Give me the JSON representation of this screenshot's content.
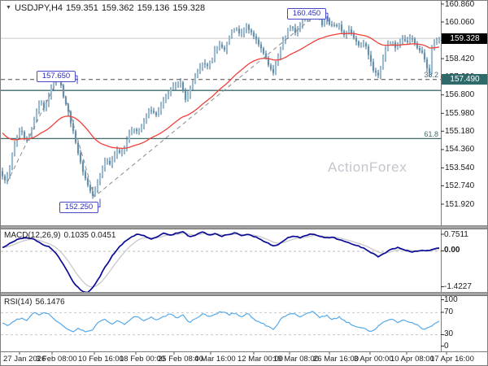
{
  "window": {
    "symbol": "USDJPY,H4",
    "quote_open": "159.351",
    "quote_high": "159.362",
    "quote_low": "159.136",
    "quote_close": "159.328"
  },
  "watermark": "ActionForex",
  "chart_data": [
    {
      "id": "price",
      "type": "candlestick",
      "title": "USDJPY,H4",
      "ohlc": {
        "open": 159.351,
        "high": 159.362,
        "low": 159.136,
        "close": 159.328
      },
      "y_axis": {
        "side": "right",
        "ticks": [
          "160.860",
          "160.060",
          "159.240",
          "158.420",
          "157.600",
          "156.800",
          "155.980",
          "155.180",
          "154.360",
          "153.540",
          "152.740",
          "151.920"
        ]
      },
      "x_axis": {
        "labels": [
          "27 Jan 2026",
          "3 Feb 08:00",
          "10 Feb 16:00",
          "18 Feb 00:00",
          "25 Feb 08:00",
          "4 Mar 16:00",
          "12 Mar 00:00",
          "19 Mar 08:00",
          "26 Mar 16:00",
          "3 Apr 00:00",
          "10 Apr 08:00",
          "17 Apr 16:00"
        ]
      },
      "current_price": {
        "value": 159.328,
        "tag": "159.328"
      },
      "levels": [
        {
          "label": "38.2",
          "price": 157.49,
          "style": "dashed",
          "tag": "157.490"
        },
        {
          "label": "",
          "price": 157.0,
          "style": "solid",
          "tag": ""
        },
        {
          "label": "61.8",
          "price": 154.85,
          "style": "solid",
          "tag": ""
        }
      ],
      "annotations": [
        {
          "label": "160.450",
          "price": 160.45,
          "x": 390,
          "box_x": 352,
          "side": "high"
        },
        {
          "label": "157.650",
          "price": 157.65,
          "x": 72,
          "box_x": 44,
          "side": "high"
        },
        {
          "label": "152.250",
          "price": 152.25,
          "x": 115,
          "box_x": 72,
          "side": "low"
        }
      ],
      "zigzag": [
        [
          8,
          152.9
        ],
        [
          72,
          157.65
        ],
        [
          115,
          152.25
        ],
        [
          390,
          160.45
        ]
      ],
      "price_path": [
        [
          0,
          153.4
        ],
        [
          6,
          152.9
        ],
        [
          12,
          153.6
        ],
        [
          20,
          154.8
        ],
        [
          26,
          155.4
        ],
        [
          32,
          154.7
        ],
        [
          38,
          155.1
        ],
        [
          44,
          155.9
        ],
        [
          50,
          156.5
        ],
        [
          56,
          156.2
        ],
        [
          62,
          157.0
        ],
        [
          68,
          157.4
        ],
        [
          72,
          157.65
        ],
        [
          78,
          156.8
        ],
        [
          84,
          156.1
        ],
        [
          90,
          155.2
        ],
        [
          96,
          154.2
        ],
        [
          102,
          153.5
        ],
        [
          108,
          152.8
        ],
        [
          115,
          152.25
        ],
        [
          122,
          153.1
        ],
        [
          130,
          153.9
        ],
        [
          136,
          153.6
        ],
        [
          144,
          154.4
        ],
        [
          150,
          154.1
        ],
        [
          158,
          154.9
        ],
        [
          164,
          155.4
        ],
        [
          170,
          155.1
        ],
        [
          178,
          155.7
        ],
        [
          186,
          156.2
        ],
        [
          192,
          155.8
        ],
        [
          200,
          156.4
        ],
        [
          208,
          156.9
        ],
        [
          214,
          157.2
        ],
        [
          222,
          157.4
        ],
        [
          228,
          156.6
        ],
        [
          234,
          157.0
        ],
        [
          242,
          157.7
        ],
        [
          250,
          158.3
        ],
        [
          256,
          158.0
        ],
        [
          264,
          158.7
        ],
        [
          270,
          159.1
        ],
        [
          276,
          158.8
        ],
        [
          284,
          159.5
        ],
        [
          290,
          159.8
        ],
        [
          296,
          159.4
        ],
        [
          304,
          159.9
        ],
        [
          310,
          159.5
        ],
        [
          318,
          159.1
        ],
        [
          324,
          158.7
        ],
        [
          330,
          158.2
        ],
        [
          337,
          157.7
        ],
        [
          344,
          158.8
        ],
        [
          352,
          159.5
        ],
        [
          358,
          159.9
        ],
        [
          364,
          159.6
        ],
        [
          372,
          160.1
        ],
        [
          380,
          160.3
        ],
        [
          390,
          160.45
        ],
        [
          396,
          159.9
        ],
        [
          402,
          160.15
        ],
        [
          410,
          159.8
        ],
        [
          416,
          160.0
        ],
        [
          424,
          159.5
        ],
        [
          430,
          159.8
        ],
        [
          436,
          159.3
        ],
        [
          442,
          158.9
        ],
        [
          448,
          159.2
        ],
        [
          454,
          158.5
        ],
        [
          460,
          157.9
        ],
        [
          465,
          157.6
        ],
        [
          470,
          158.3
        ],
        [
          476,
          158.9
        ],
        [
          482,
          159.2
        ],
        [
          488,
          158.9
        ],
        [
          494,
          159.3
        ],
        [
          500,
          159.1
        ],
        [
          506,
          159.4
        ],
        [
          512,
          159.0
        ],
        [
          518,
          158.8
        ],
        [
          524,
          158.3
        ],
        [
          528,
          157.6
        ],
        [
          532,
          159.0
        ],
        [
          536,
          159.2
        ],
        [
          541,
          159.33
        ]
      ],
      "ma": {
        "name": "EMA",
        "color": "#ef4038"
      },
      "colors": {
        "candle_up": "#9cbcd2",
        "candle_down": "#6490ae",
        "candle_line": "#36688e",
        "current_line": "#c9c9c9",
        "level_solid": "#3f6b6b",
        "level_dashed": "#4a4a4a",
        "zigzag": "#8a8a8a",
        "annotation": "#4848c8"
      }
    },
    {
      "id": "macd",
      "type": "line",
      "title": "MACD(12,26,9)",
      "values": "0.1035 0.0451",
      "y_axis": {
        "ticks": [
          "0.7511",
          "0.00",
          "-1.4227"
        ],
        "max": 0.7511,
        "min": -1.4227
      },
      "series": [
        {
          "name": "signal",
          "color": "#c9c9c9"
        },
        {
          "name": "macd",
          "color": "#0a0a96"
        }
      ],
      "path": [
        [
          0,
          0.1
        ],
        [
          10,
          0.25
        ],
        [
          20,
          0.4
        ],
        [
          30,
          0.48
        ],
        [
          40,
          0.42
        ],
        [
          50,
          0.25
        ],
        [
          60,
          0.15
        ],
        [
          70,
          -0.15
        ],
        [
          80,
          -0.6
        ],
        [
          90,
          -1.1
        ],
        [
          100,
          -1.38
        ],
        [
          108,
          -1.42
        ],
        [
          118,
          -1.05
        ],
        [
          128,
          -0.55
        ],
        [
          138,
          -0.12
        ],
        [
          148,
          0.22
        ],
        [
          158,
          0.45
        ],
        [
          168,
          0.6
        ],
        [
          176,
          0.54
        ],
        [
          184,
          0.42
        ],
        [
          192,
          0.5
        ],
        [
          200,
          0.62
        ],
        [
          208,
          0.54
        ],
        [
          216,
          0.62
        ],
        [
          224,
          0.68
        ],
        [
          232,
          0.5
        ],
        [
          240,
          0.56
        ],
        [
          248,
          0.66
        ],
        [
          256,
          0.55
        ],
        [
          264,
          0.6
        ],
        [
          272,
          0.52
        ],
        [
          280,
          0.58
        ],
        [
          288,
          0.63
        ],
        [
          296,
          0.55
        ],
        [
          304,
          0.58
        ],
        [
          312,
          0.5
        ],
        [
          320,
          0.4
        ],
        [
          328,
          0.28
        ],
        [
          336,
          0.17
        ],
        [
          344,
          0.28
        ],
        [
          352,
          0.45
        ],
        [
          360,
          0.52
        ],
        [
          368,
          0.47
        ],
        [
          376,
          0.55
        ],
        [
          384,
          0.6
        ],
        [
          392,
          0.52
        ],
        [
          400,
          0.45
        ],
        [
          408,
          0.48
        ],
        [
          416,
          0.4
        ],
        [
          424,
          0.34
        ],
        [
          432,
          0.24
        ],
        [
          440,
          0.17
        ],
        [
          448,
          0.09
        ],
        [
          456,
          -0.06
        ],
        [
          464,
          -0.18
        ],
        [
          470,
          -0.1
        ],
        [
          476,
          0.02
        ],
        [
          482,
          0.08
        ],
        [
          488,
          0.12
        ],
        [
          494,
          0.07
        ],
        [
          500,
          0.02
        ],
        [
          506,
          -0.02
        ],
        [
          512,
          0.0
        ],
        [
          518,
          0.04
        ],
        [
          524,
          0.02
        ],
        [
          530,
          0.06
        ],
        [
          536,
          0.09
        ],
        [
          541,
          0.1
        ]
      ]
    },
    {
      "id": "rsi",
      "type": "line",
      "title": "RSI(14)",
      "values": "56.1476",
      "y_axis": {
        "ticks": [
          "100",
          "70",
          "30",
          "0"
        ],
        "max": 100,
        "min": 0,
        "guides": [
          70,
          30
        ]
      },
      "series": [
        {
          "name": "rsi",
          "color": "#55a9e8"
        }
      ],
      "path": [
        [
          0,
          52
        ],
        [
          8,
          47
        ],
        [
          16,
          55
        ],
        [
          24,
          60
        ],
        [
          32,
          55
        ],
        [
          40,
          72
        ],
        [
          48,
          66
        ],
        [
          56,
          70
        ],
        [
          64,
          62
        ],
        [
          72,
          50
        ],
        [
          80,
          42
        ],
        [
          88,
          36
        ],
        [
          96,
          42
        ],
        [
          104,
          35
        ],
        [
          112,
          38
        ],
        [
          120,
          52
        ],
        [
          128,
          58
        ],
        [
          136,
          50
        ],
        [
          144,
          57
        ],
        [
          152,
          48
        ],
        [
          160,
          60
        ],
        [
          168,
          64
        ],
        [
          176,
          55
        ],
        [
          184,
          62
        ],
        [
          192,
          56
        ],
        [
          200,
          63
        ],
        [
          208,
          67
        ],
        [
          216,
          61
        ],
        [
          224,
          66
        ],
        [
          232,
          52
        ],
        [
          240,
          60
        ],
        [
          248,
          68
        ],
        [
          256,
          62
        ],
        [
          264,
          68
        ],
        [
          272,
          72
        ],
        [
          280,
          66
        ],
        [
          288,
          70
        ],
        [
          296,
          63
        ],
        [
          304,
          68
        ],
        [
          312,
          58
        ],
        [
          320,
          52
        ],
        [
          328,
          45
        ],
        [
          336,
          40
        ],
        [
          344,
          58
        ],
        [
          352,
          66
        ],
        [
          360,
          70
        ],
        [
          368,
          62
        ],
        [
          376,
          68
        ],
        [
          384,
          72
        ],
        [
          392,
          60
        ],
        [
          400,
          66
        ],
        [
          408,
          58
        ],
        [
          416,
          62
        ],
        [
          424,
          54
        ],
        [
          432,
          48
        ],
        [
          440,
          44
        ],
        [
          448,
          40
        ],
        [
          456,
          35
        ],
        [
          464,
          45
        ],
        [
          472,
          55
        ],
        [
          480,
          58
        ],
        [
          488,
          52
        ],
        [
          496,
          58
        ],
        [
          504,
          52
        ],
        [
          512,
          48
        ],
        [
          520,
          40
        ],
        [
          528,
          44
        ],
        [
          536,
          52
        ],
        [
          541,
          56
        ]
      ]
    }
  ]
}
